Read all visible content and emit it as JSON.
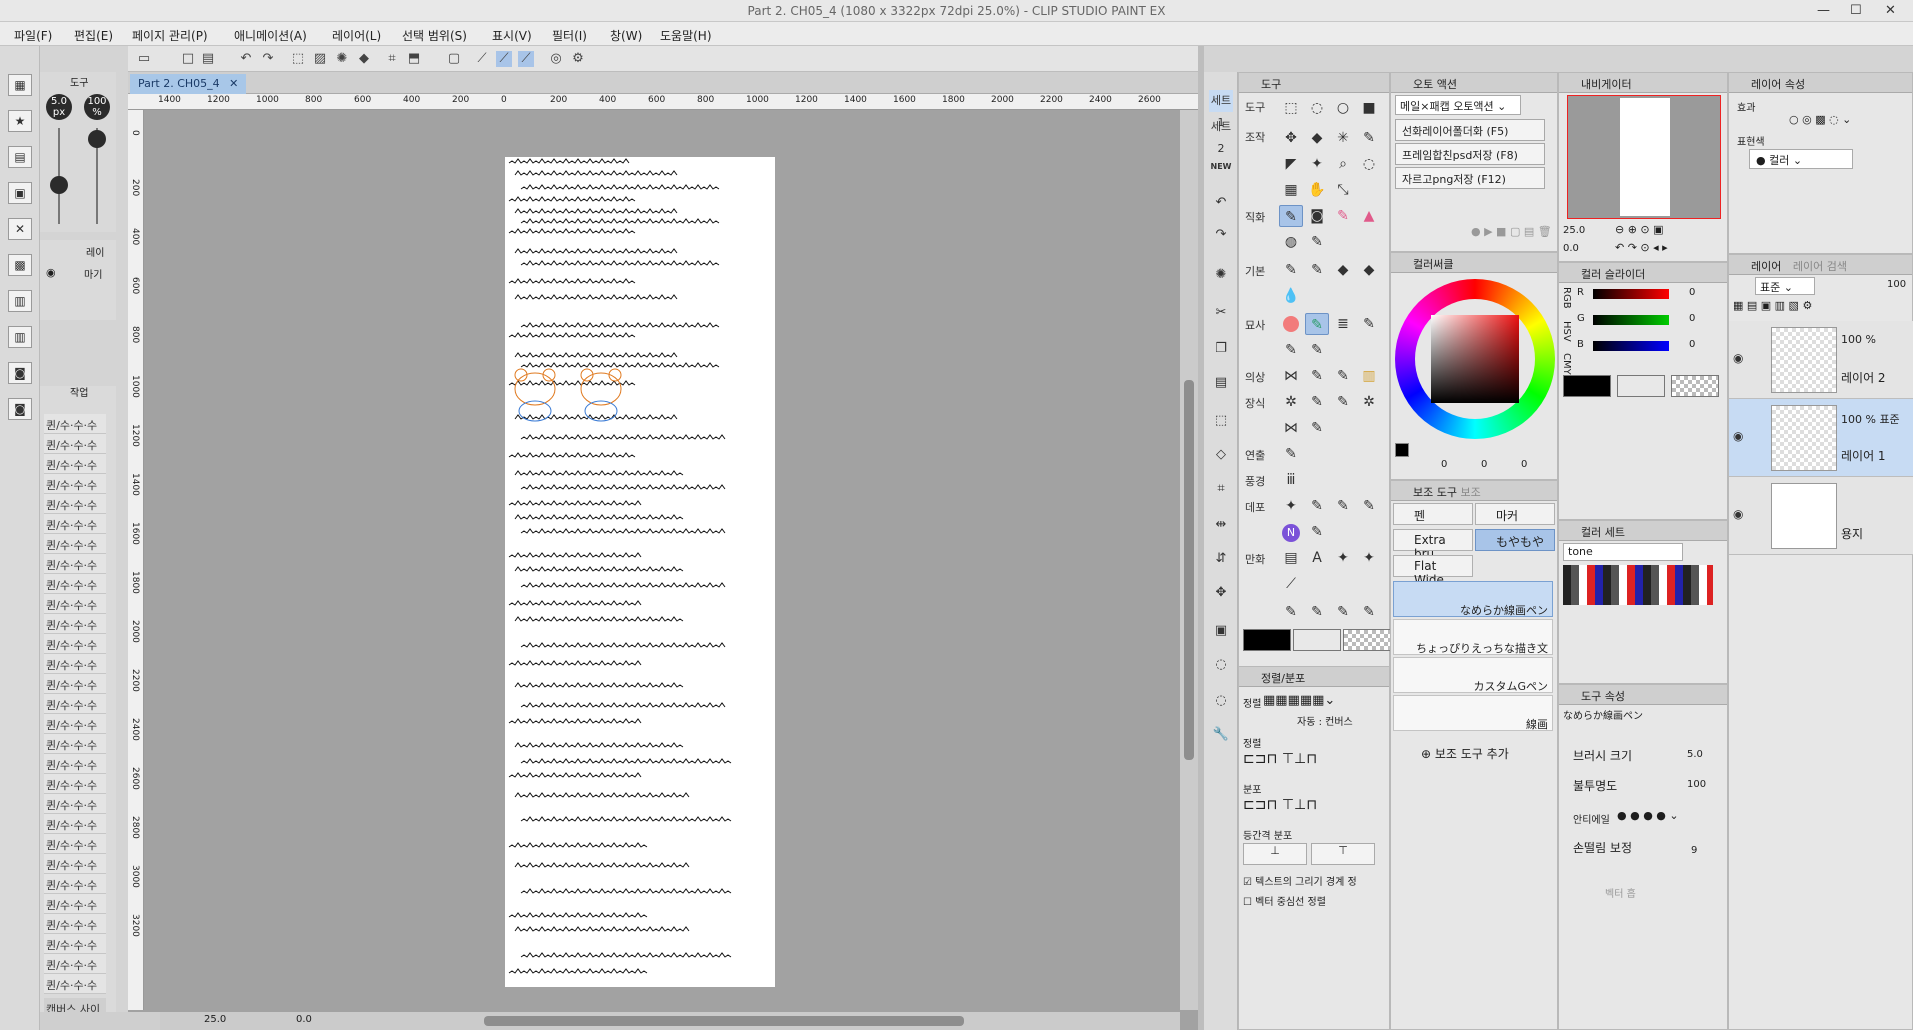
{
  "window": {
    "title": "Part 2. CH05_4 (1080 x 3322px 72dpi 25.0%) - CLIP STUDIO PAINT EX",
    "min": "—",
    "max": "☐",
    "close": "✕"
  },
  "menu": [
    "파일(F)",
    "편집(E)",
    "페이지 관리(P)",
    "애니메이션(A)",
    "레이어(L)",
    "선택 범위(S)",
    "표시(V)",
    "필터(I)",
    "창(W)",
    "도움말(H)"
  ],
  "document": {
    "tab": "Part 2. CH05_4",
    "tab_close": "✕",
    "zoom": "25.0",
    "angle": "0.0"
  },
  "rulers": {
    "h_ticks": [
      "1400",
      "1200",
      "1000",
      "800",
      "600",
      "400",
      "200",
      "0",
      "200",
      "400",
      "600",
      "800",
      "1000",
      "1200",
      "1400",
      "1600",
      "1800",
      "2000",
      "2200",
      "2400",
      "2600"
    ],
    "v_ticks": [
      "0",
      "200",
      "400",
      "600",
      "800",
      "1000",
      "1200",
      "1400",
      "1600",
      "1800",
      "2000",
      "2200",
      "2400",
      "2600",
      "2800",
      "3000",
      "3200"
    ]
  },
  "left": {
    "tool_label": "도구",
    "brush_size": "5.0",
    "brush_unit": "px",
    "opacity": "100",
    "opacity_unit": "%",
    "layer_label": "레이",
    "layer_item": "마기",
    "work_label": "작업",
    "rows": [
      "퀸/수·수·수",
      "퀸/수·수·수",
      "퀸/수·수·수",
      "퀸/수·수·수",
      "퀸/수·수·수",
      "퀸/수·수·수",
      "퀸/수·수·수",
      "퀸/수·수·수",
      "퀸/수·수·수",
      "퀸/수·수·수",
      "퀸/수·수·수",
      "퀸/수·수·수",
      "퀸/수·수·수",
      "퀸/수·수·수",
      "퀸/수·수·수",
      "퀸/수·수·수",
      "퀸/수·수·수",
      "퀸/수·수·수",
      "퀸/수·수·수",
      "퀸/수·수·수",
      "퀸/수·수·수",
      "퀸/수·수·수",
      "퀸/수·수·수",
      "퀸/수·수·수",
      "퀸/수·수·수",
      "퀸/수·수·수",
      "퀸/수·수·수",
      "퀸/수·수·수",
      "퀸/수·수·수"
    ],
    "canvas_size": "캔버스 사이"
  },
  "strip": {
    "set1": "세트1",
    "set2": "세트2",
    "new": "NEW"
  },
  "toolpanel": {
    "title": "도구",
    "categories": [
      "도구",
      "조작",
      "직화",
      "기본",
      "묘사",
      "의상",
      "장식",
      "연출",
      "풍경",
      "데포",
      "만화"
    ],
    "align_title": "정렬/분포",
    "align_mode_label": "정렬",
    "align_target_label": "자동 : 컨버스",
    "align_label": "정렬",
    "dist_label": "분포",
    "equal_label": "등간격 분포",
    "check1": "텍스트의 그리기 경계 정",
    "check2": "벡터 중심선 정렬"
  },
  "auto": {
    "title": "오토 액션",
    "select": "메일×패캡 오토액션",
    "actions": [
      "선화레이어폴더화 (F5)",
      "프레임합친psd저장 (F8)",
      "자르고png저장 (F12)"
    ],
    "frame": "25.0",
    "frame2": "0.0"
  },
  "colorwheel": {
    "title": "컬러써클",
    "h": "0",
    "s": "0",
    "v": "0"
  },
  "subtool": {
    "title": "보조 도구",
    "tab2": "보조",
    "buttons": [
      "펜",
      "마커",
      "Extra bru",
      "もやもや",
      "Flat Wide"
    ],
    "brushes": [
      "なめらか線画ペン",
      "ちょっぴりえっちな描き文",
      "カスタムGペン",
      "線画"
    ],
    "add": "보조 도구 추가"
  },
  "navigator": {
    "title": "내비게이터",
    "zoom": "25.0",
    "angle": "0.0"
  },
  "sliders": {
    "title": "컬러 슬라이더",
    "labels": [
      "R",
      "G",
      "B"
    ],
    "values": [
      "0",
      "0",
      "0"
    ],
    "modes": [
      "RGB",
      "HSV",
      "CMY"
    ]
  },
  "colorset": {
    "title": "컬러 세트",
    "select": "tone"
  },
  "toolprop": {
    "title": "도구 속성",
    "brush": "なめらか線画ペン",
    "size_label": "브러시 크기",
    "size": "5.0",
    "opacity_label": "불투명도",
    "opacity": "100",
    "aa_label": "안티에일",
    "stab_label": "손떨림 보정",
    "stab": "9",
    "vector_label": "벡터 흡"
  },
  "layerprop": {
    "title": "레이어 속성",
    "effect": "효과",
    "expression": "표현색",
    "color": "컬러"
  },
  "layers": {
    "title": "레이어",
    "tab2": "레이어 검색",
    "blend": "표준",
    "opacity": "100",
    "items": [
      {
        "pct": "100 %",
        "name": "레이어 2"
      },
      {
        "pct": "100 % 표준",
        "name": "레이어 1"
      },
      {
        "pct": "",
        "name": "용지"
      }
    ]
  },
  "colors": {
    "main": "#000000",
    "sub": "#e8e8e8",
    "accent": "#a8c4e8",
    "title_text": "#666666"
  }
}
